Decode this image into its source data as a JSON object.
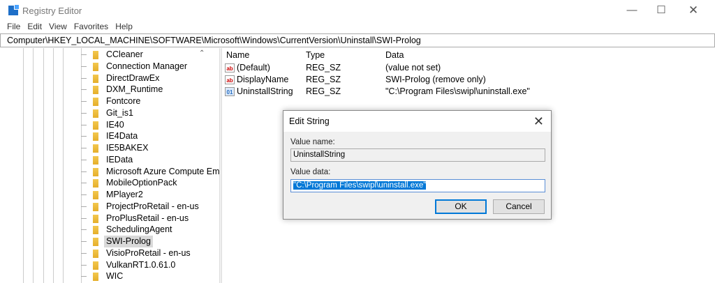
{
  "window": {
    "title": "Registry Editor",
    "controls": [
      "minimize",
      "maximize",
      "close"
    ]
  },
  "menu": [
    "File",
    "Edit",
    "View",
    "Favorites",
    "Help"
  ],
  "address": "Computer\\HKEY_LOCAL_MACHINE\\SOFTWARE\\Microsoft\\Windows\\CurrentVersion\\Uninstall\\SWI-Prolog",
  "tree": {
    "items": [
      "CCleaner",
      "Connection Manager",
      "DirectDrawEx",
      "DXM_Runtime",
      "Fontcore",
      "Git_is1",
      "IE40",
      "IE4Data",
      "IE5BAKEX",
      "IEData",
      "Microsoft Azure Compute Em",
      "MobileOptionPack",
      "MPlayer2",
      "ProjectProRetail - en-us",
      "ProPlusRetail - en-us",
      "SchedulingAgent",
      "SWI-Prolog",
      "VisioProRetail - en-us",
      "VulkanRT1.0.61.0",
      "WIC"
    ],
    "selected": "SWI-Prolog"
  },
  "list": {
    "headers": [
      "Name",
      "Type",
      "Data"
    ],
    "rows": [
      {
        "icon": "string-value-icon",
        "name": "(Default)",
        "type": "REG_SZ",
        "data": "(value not set)"
      },
      {
        "icon": "string-value-icon",
        "name": "DisplayName",
        "type": "REG_SZ",
        "data": "SWI-Prolog (remove only)"
      },
      {
        "icon": "binary-value-icon",
        "name": "UninstallString",
        "type": "REG_SZ",
        "data": "\"C:\\Program Files\\swipl\\uninstall.exe\""
      }
    ]
  },
  "dialog": {
    "title": "Edit String",
    "value_name_label": "Value name:",
    "value_name": "UninstallString",
    "value_data_label": "Value data:",
    "value_data": "\"C:\\Program Files\\swipl\\uninstall.exe\"",
    "ok": "OK",
    "cancel": "Cancel"
  }
}
